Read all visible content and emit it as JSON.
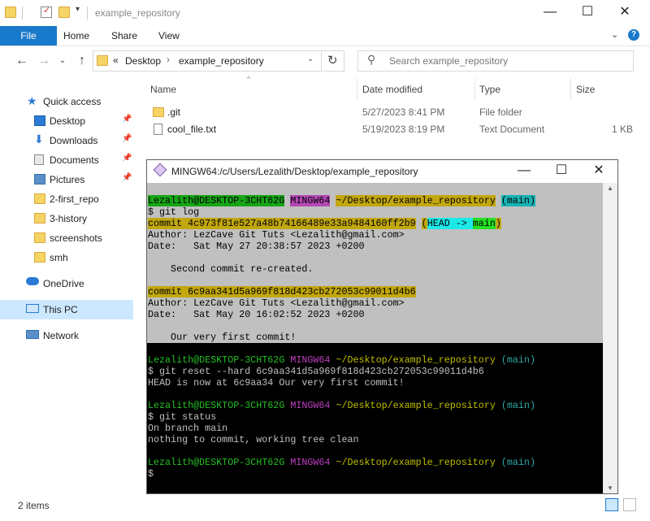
{
  "window": {
    "title": "example_repository"
  },
  "ribbon": {
    "file": "File",
    "home": "Home",
    "share": "Share",
    "view": "View"
  },
  "address": {
    "root": "«",
    "desktop": "Desktop",
    "folder": "example_repository"
  },
  "search": {
    "placeholder": "Search example_repository"
  },
  "nav": [
    {
      "label": "Quick access",
      "icon": "star-icon"
    },
    {
      "label": "Desktop",
      "icon": "desktop-icon",
      "pinned": true
    },
    {
      "label": "Downloads",
      "icon": "download-icon",
      "pinned": true
    },
    {
      "label": "Documents",
      "icon": "documents-icon",
      "pinned": true
    },
    {
      "label": "Pictures",
      "icon": "pictures-icon",
      "pinned": true
    },
    {
      "label": "2-first_repo",
      "icon": "folder-icon"
    },
    {
      "label": "3-history",
      "icon": "folder-icon"
    },
    {
      "label": "screenshots",
      "icon": "folder-icon"
    },
    {
      "label": "smh",
      "icon": "folder-icon"
    },
    {
      "label": "OneDrive",
      "icon": "cloud-icon"
    },
    {
      "label": "This PC",
      "icon": "pc-icon",
      "selected": true
    },
    {
      "label": "Network",
      "icon": "network-icon"
    }
  ],
  "columns": {
    "name": "Name",
    "date": "Date modified",
    "type": "Type",
    "size": "Size"
  },
  "files": [
    {
      "name": ".git",
      "date": "5/27/2023 8:41 PM",
      "type": "File folder",
      "size": ""
    },
    {
      "name": "cool_file.txt",
      "date": "5/19/2023 8:19 PM",
      "type": "Text Document",
      "size": "1 KB"
    }
  ],
  "status": {
    "items": "2 items"
  },
  "terminal": {
    "title": "MINGW64:/c/Users/Lezalith/Desktop/example_repository",
    "prompt_user": "Lezalith@DESKTOP-3CHT62G",
    "prompt_env": "MINGW64",
    "prompt_path": "~/Desktop/example_repository",
    "prompt_branch": "(main)",
    "cmd1": "$ git log",
    "commit1": "commit 4c973f81e527a48b74166489e33a9484160ff2b9",
    "commit1_open": "(",
    "commit1_head": "HEAD -> ",
    "commit1_main": "main",
    "commit1_close": ")",
    "author": "Author: LezCave Git Tuts <Lezalith@gmail.com>",
    "date1": "Date:   Sat May 27 20:38:57 2023 +0200",
    "msg1": "    Second commit re-created.",
    "commit2": "commit 6c9aa341d5a969f818d423cb272053c99011d4b6",
    "date2": "Date:   Sat May 20 16:02:52 2023 +0200",
    "msg2": "    Our very first commit!",
    "cmd2": "$ git reset --hard 6c9aa341d5a969f818d423cb272053c99011d4b6",
    "out2": "HEAD is now at 6c9aa34 Our very first commit!",
    "cmd3": "$ git status",
    "out3a": "On branch main",
    "out3b": "nothing to commit, working tree clean",
    "cmd4": "$"
  }
}
